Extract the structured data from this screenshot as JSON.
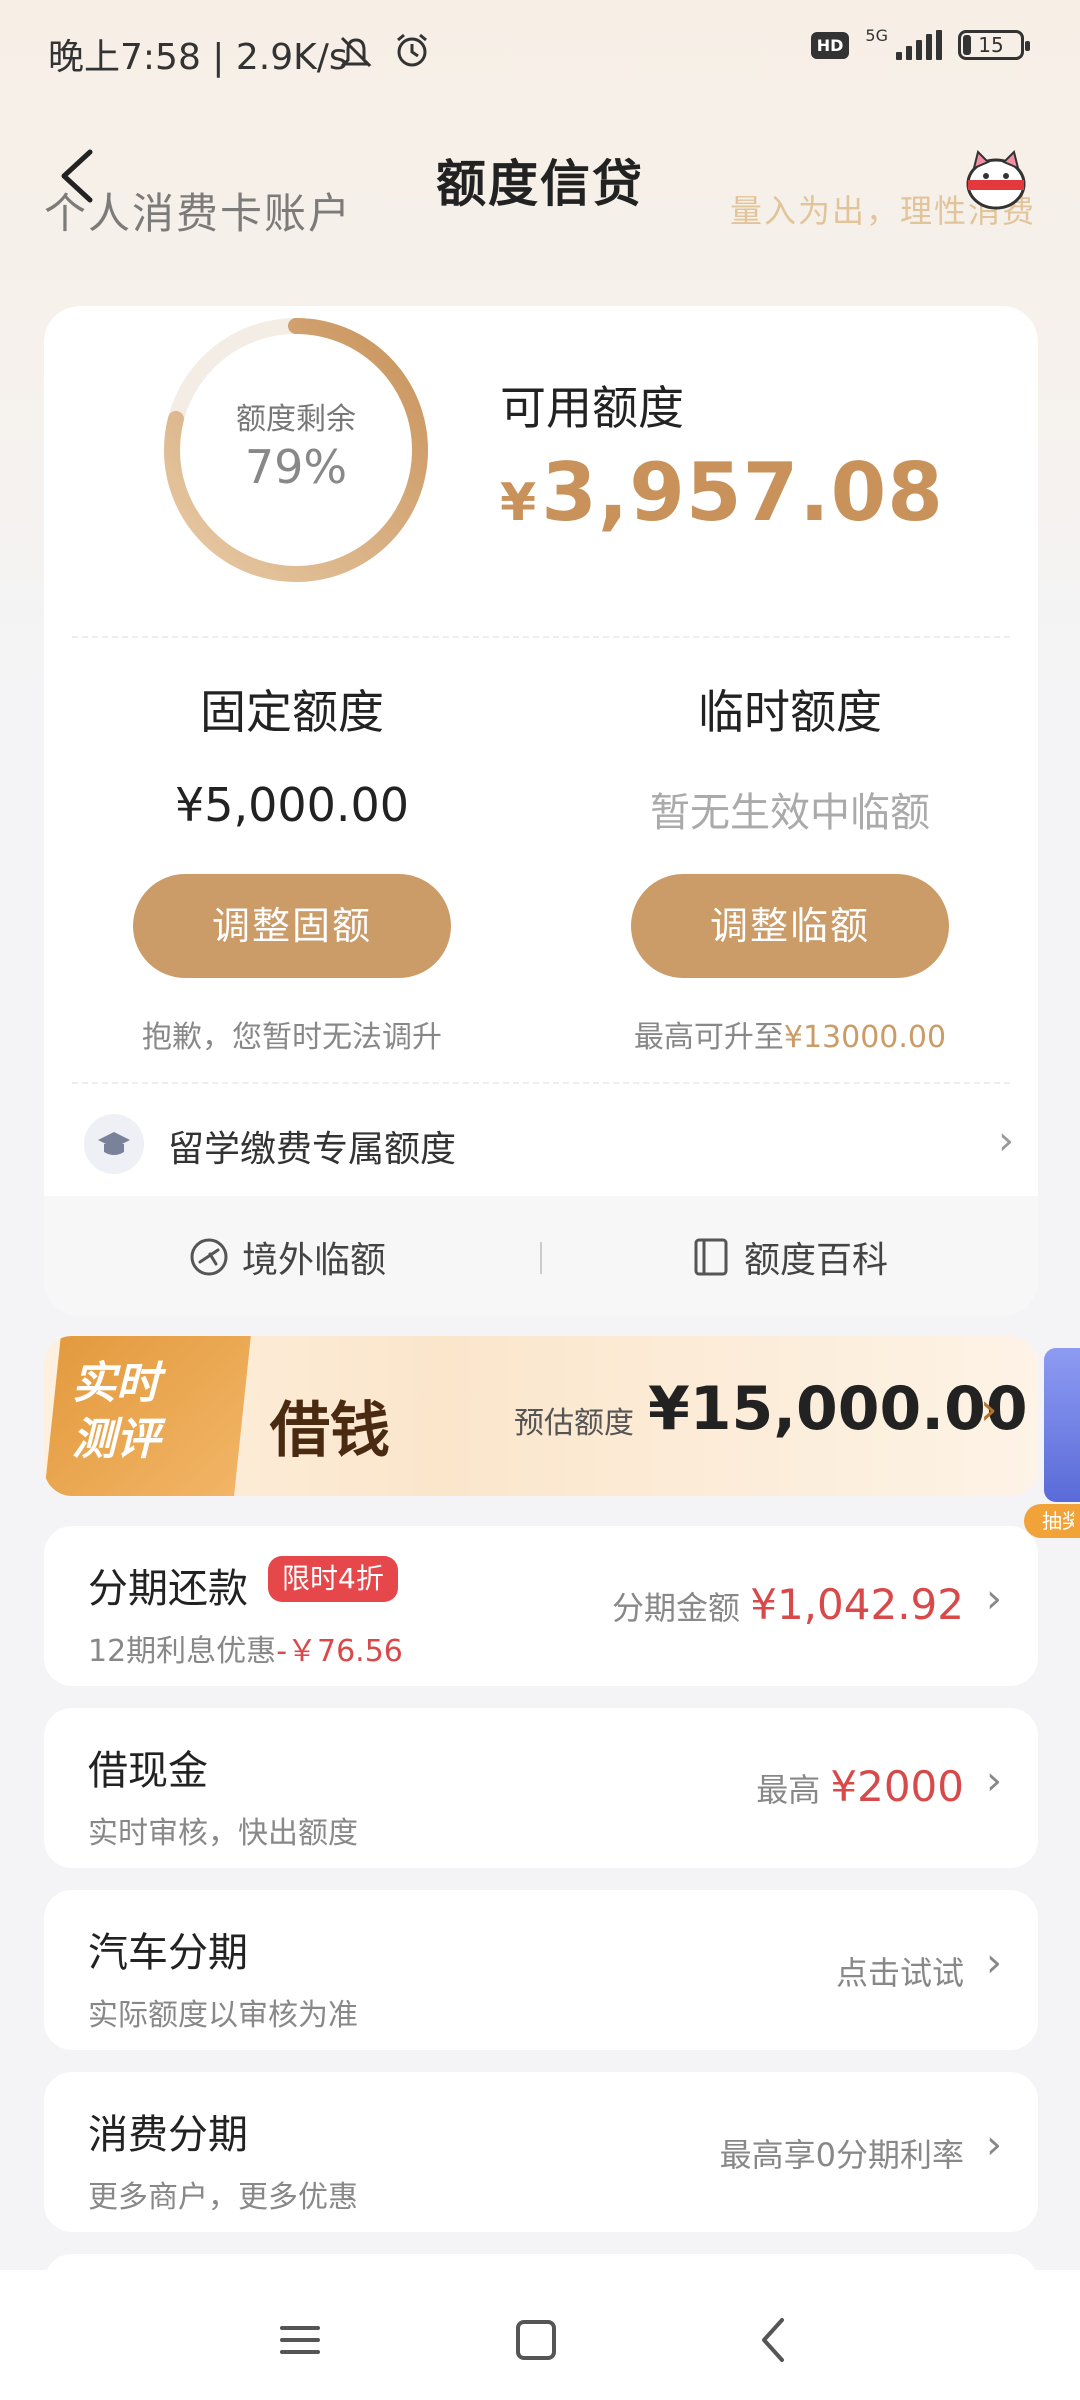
{
  "status_bar": {
    "time": "晚上7:58 | 2.9K/s",
    "network": "5G",
    "battery": "15"
  },
  "header": {
    "title": "额度信贷",
    "bg_subtitle": "个人消费卡账户",
    "slogan": "量入为出，理性消费"
  },
  "credit": {
    "ring_label": "额度剩余",
    "ring_percent": "79%",
    "ring_fraction": 0.79,
    "available_label": "可用额度",
    "available_currency": "¥",
    "available_amount": "3,957.08",
    "fixed": {
      "title": "固定额度",
      "value": "¥5,000.00",
      "button": "调整固额",
      "note": "抱歉，您暂时无法调升"
    },
    "temporary": {
      "title": "临时额度",
      "value": "暂无生效中临额",
      "button": "调整临额",
      "note_prefix": "最高可升至",
      "note_amount": "¥13000.00"
    },
    "study_label": "留学缴费专属额度",
    "links": {
      "overseas": "境外临额",
      "wiki": "额度百科"
    }
  },
  "banner": {
    "tag_line1": "实时",
    "tag_line2": "测评",
    "title": "借钱",
    "est_label": "预估额度",
    "est_amount": "¥15,000.00",
    "side_tag": "抽奖"
  },
  "items": [
    {
      "title": "分期还款",
      "badge": "限时4折",
      "sub_prefix": "12期利息优惠",
      "sub_neg": "-￥76.56",
      "right_label": "分期金额",
      "right_value": "¥1,042.92"
    },
    {
      "title": "借现金",
      "sub": "实时审核，快出额度",
      "right_label": "最高",
      "right_value": "¥2000"
    },
    {
      "title": "汽车分期",
      "sub": "实际额度以审核为准",
      "right_label": "点击试试"
    },
    {
      "title": "消费分期",
      "sub": "更多商户，更多优惠",
      "right_label": "最高享0分期利率"
    }
  ],
  "colors": {
    "gold": "#cb9b68",
    "red": "#d84a4a",
    "banner_orange": "#e39a3e"
  },
  "icons": [
    "back-icon",
    "mascot-icon",
    "graduation-cap-icon",
    "plane-icon",
    "book-icon",
    "menu-icon",
    "home-icon",
    "nav-back-icon"
  ]
}
